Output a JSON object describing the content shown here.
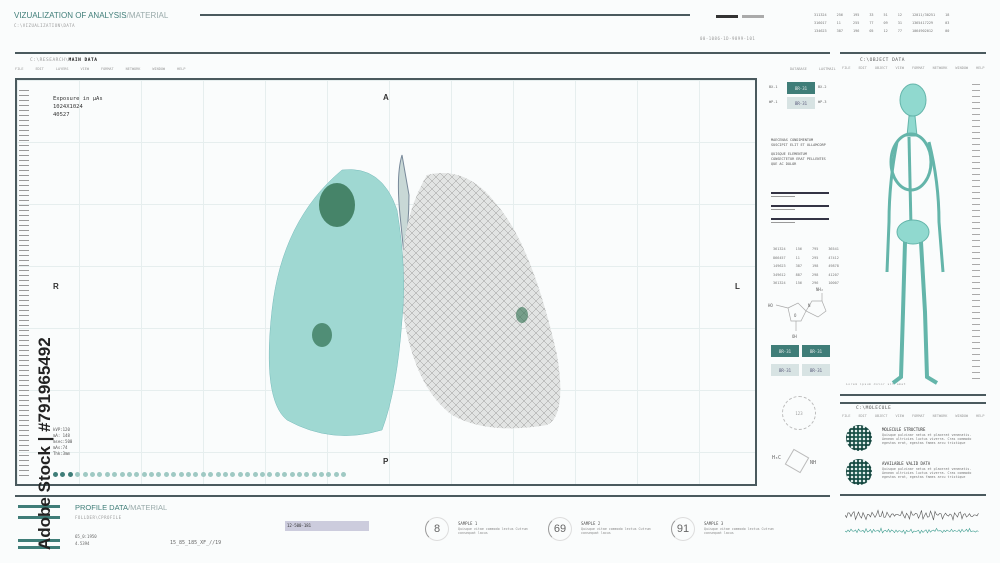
{
  "header": {
    "title_main": "VIZUALIZATION OF ANALYSIS",
    "title_sub": "/MATERIAL",
    "path": "C:\\VIZUALIZATION\\DATA",
    "code": "00-1086-1D-9899-101"
  },
  "top_table": [
    [
      "311324",
      "256",
      "195",
      "33",
      "51",
      "12",
      "12011/30251",
      "18"
    ],
    [
      "316017",
      "11",
      "255",
      "77",
      "09",
      "31",
      "1365417229",
      "03"
    ],
    [
      "134623",
      "387",
      "196",
      "05",
      "12",
      "77",
      "1064902012",
      "00"
    ]
  ],
  "main": {
    "path": "C:\\RESEARCH\\",
    "title": "MAIN DATA",
    "menu": [
      "FILE",
      "EDIT",
      "LAYERS",
      "VIEW",
      "FORMAT",
      "NETWORK",
      "WINDOW",
      "HELP"
    ],
    "right_menu": [
      "DATABASE",
      "LASTMAIL"
    ],
    "exposure_label": "Exposure in µAs",
    "resolution": "1024X1024",
    "value": "40527",
    "orient": {
      "a": "A",
      "p": "P",
      "r": "R",
      "l": "L"
    },
    "stats": [
      "kVP:120",
      "mA: 148",
      "msec:500",
      "mAs:74",
      "Thk:3mm"
    ],
    "dots_total": 40,
    "dots_active": 3
  },
  "side": {
    "row1": [
      "BX-1",
      "BR-31",
      "BX-2"
    ],
    "row2": [
      "WP-1",
      "BR-31",
      "WP-3"
    ],
    "text1": [
      "MAECENAS CONDIMENTUM",
      "SUSCIPIT ELIT ET ULLAMCORP"
    ],
    "text2": [
      "QUISQUE ELEMENTUM",
      "CONSECTETUR ERAT PELLENTES",
      "QUE AC DOLOR"
    ],
    "table": [
      [
        "361324",
        "156",
        "795",
        "36541"
      ],
      [
        "866457",
        "11",
        "295",
        "47412"
      ],
      [
        "149623",
        "387",
        "198",
        "49878"
      ],
      [
        "349612",
        "887",
        "298",
        "41207"
      ],
      [
        "361324",
        "156",
        "296",
        "10007"
      ]
    ],
    "chem": {
      "nh2": "NH₂",
      "n": "N",
      "ho": "HO",
      "o": "O",
      "oh": "OH",
      "h3c": "H₃C",
      "nh": "NH"
    },
    "buttons": [
      "BR-31",
      "BR-31",
      "BR-31",
      "BR-31"
    ],
    "gauge": "123"
  },
  "object": {
    "title": "C:\\OBJECT DATA",
    "menu": [
      "FILE",
      "EDIT",
      "OBJECT",
      "VIEW",
      "FORMAT",
      "NETWORK",
      "WINDOW",
      "HELP"
    ],
    "caption": "Lorem ipsum dolor sit amet"
  },
  "molecule": {
    "title": "C:\\MOLECULE",
    "menu": [
      "FILE",
      "EDIT",
      "OBJECT",
      "VIEW",
      "FORMAT",
      "NETWORK",
      "WINDOW",
      "HELP"
    ],
    "items": [
      {
        "title": "MOLECULE STRUCTURE",
        "text": "Quisque pulvinar netus et placerat venenatis. Aenean ultricies luctus viverra. Cras commodo egestas erat, egestas fames arcu tristique"
      },
      {
        "title": "AVAILABLE VALID DATA",
        "text": "Quisque pulvinar netus et placerat venenatis. Aenean ultricies luctus viverra. Cras commodo egestas erat, egestas fames arcu tristique"
      }
    ]
  },
  "profile": {
    "title_main": "PROFILE DATA",
    "title_sub": "/MATERIAL",
    "path": "FOLLDER\\CPROFILE",
    "val1": "65_0:1950",
    "val2": "4.5394",
    "code": "15_85_185_XF_//19",
    "box": "12-500-181"
  },
  "samples": [
    {
      "value": "8",
      "label": "SAMPLE 1",
      "text": "Quisque vitae commodo lectus Cutrum consequat lacus"
    },
    {
      "value": "69",
      "label": "SAMPLE 2",
      "text": "Quisque vitae commodo lectus Cutrum consequat lacus"
    },
    {
      "value": "91",
      "label": "SAMPLE 3",
      "text": "Quisque vitae commodo lectus Cutrum consequat lacus"
    }
  ],
  "watermark": "Adobe Stock | #791965492",
  "colors": {
    "accent": "#3f7d78",
    "lung": "#9fd8d2",
    "line": "#4a5a5e"
  }
}
